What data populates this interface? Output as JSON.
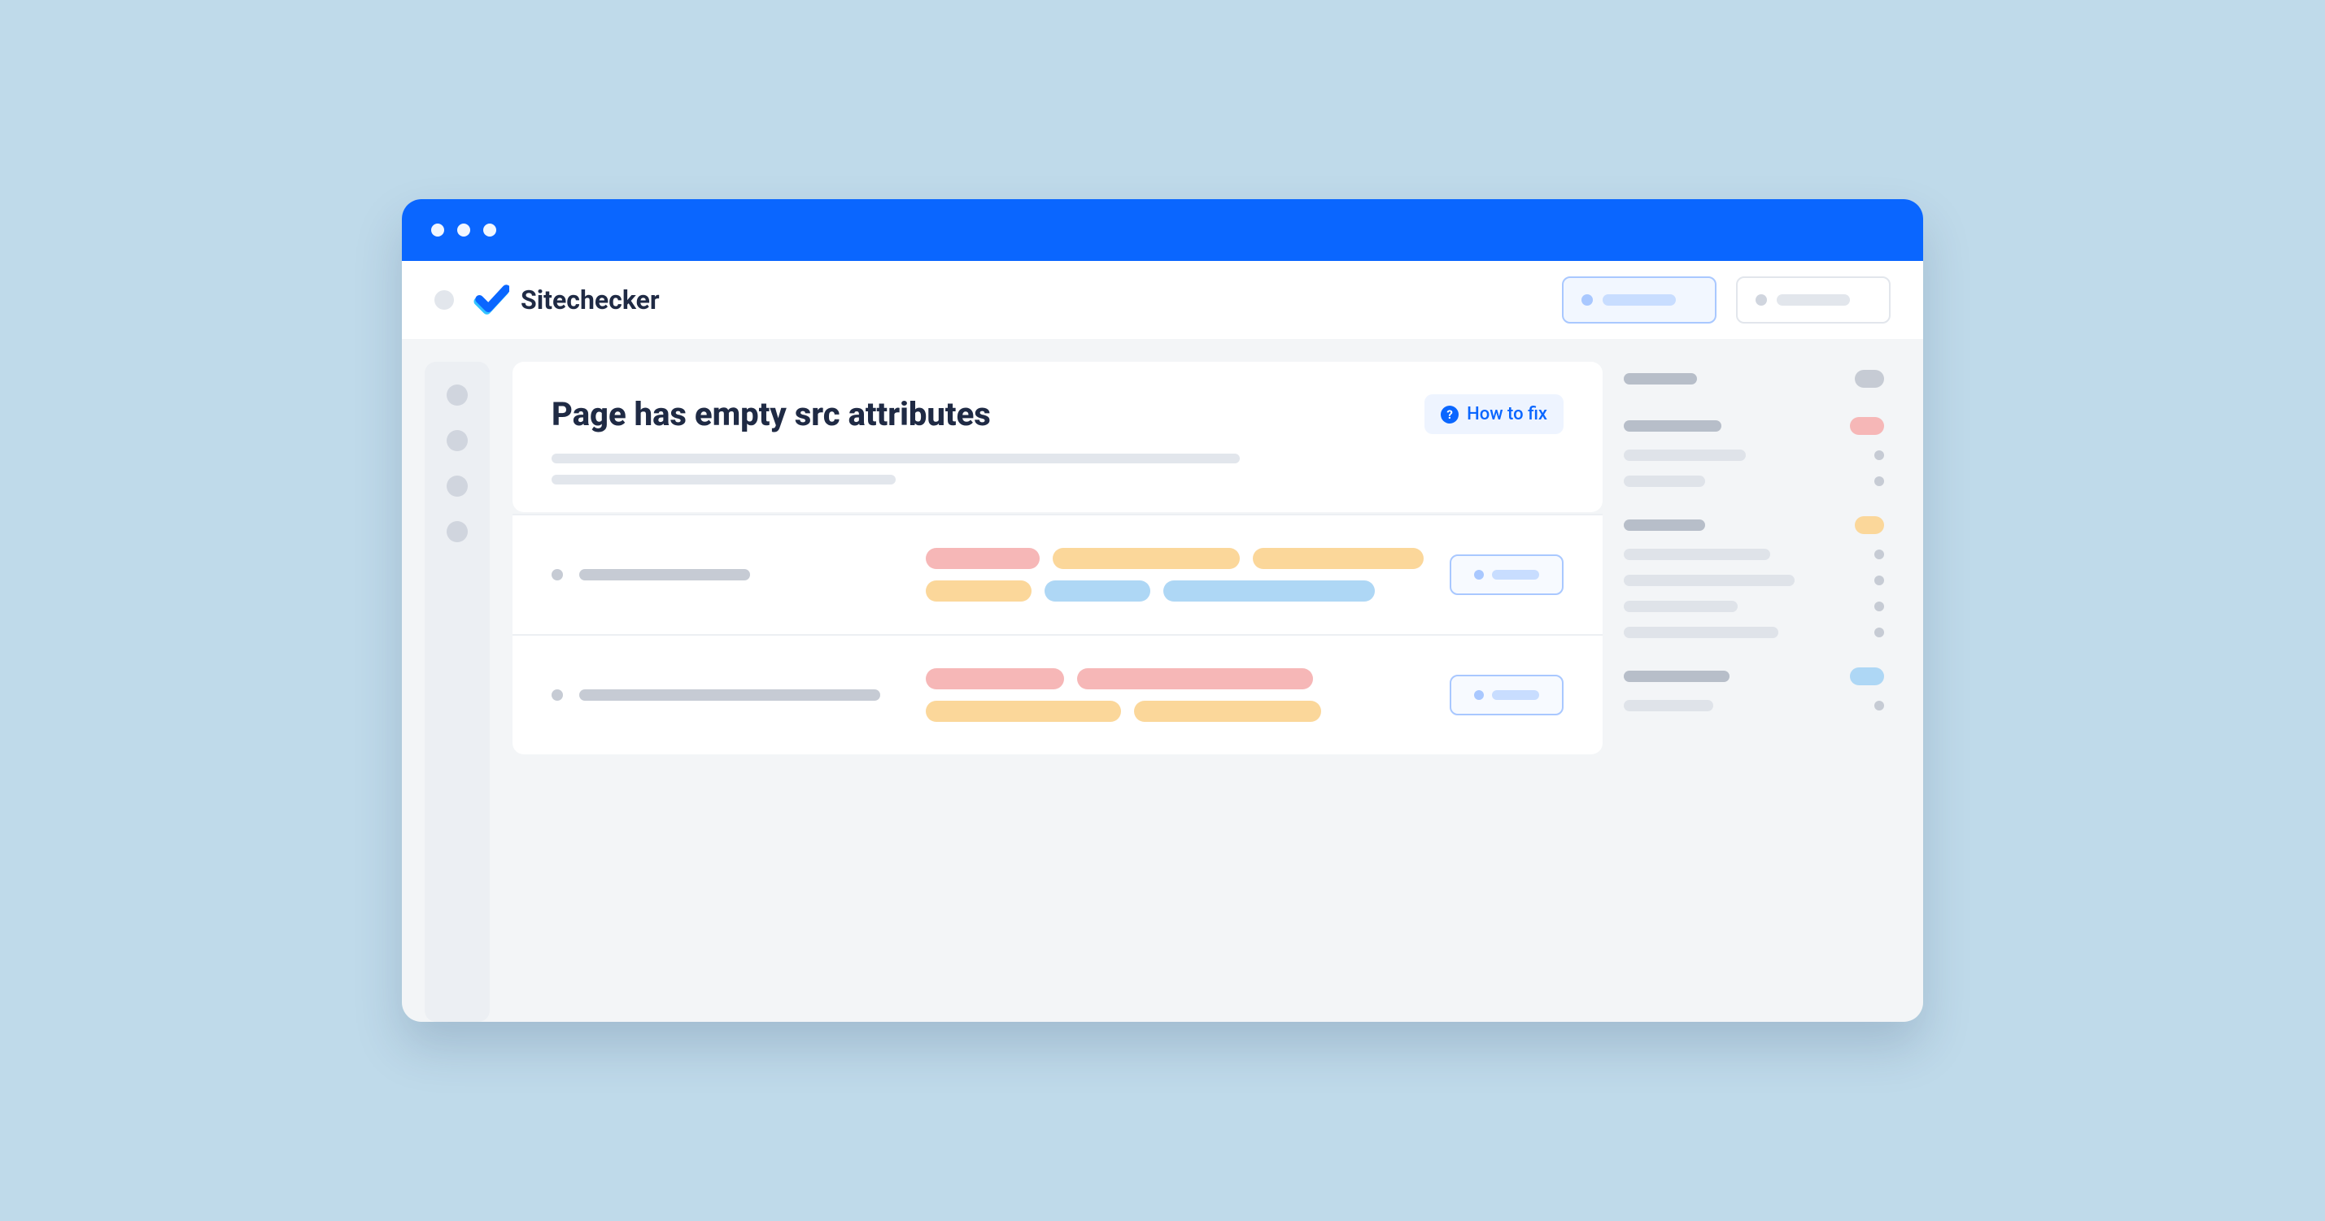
{
  "brand": "Sitechecker",
  "page_title": "Page has empty src attributes",
  "how_to_fix": "How to fix"
}
